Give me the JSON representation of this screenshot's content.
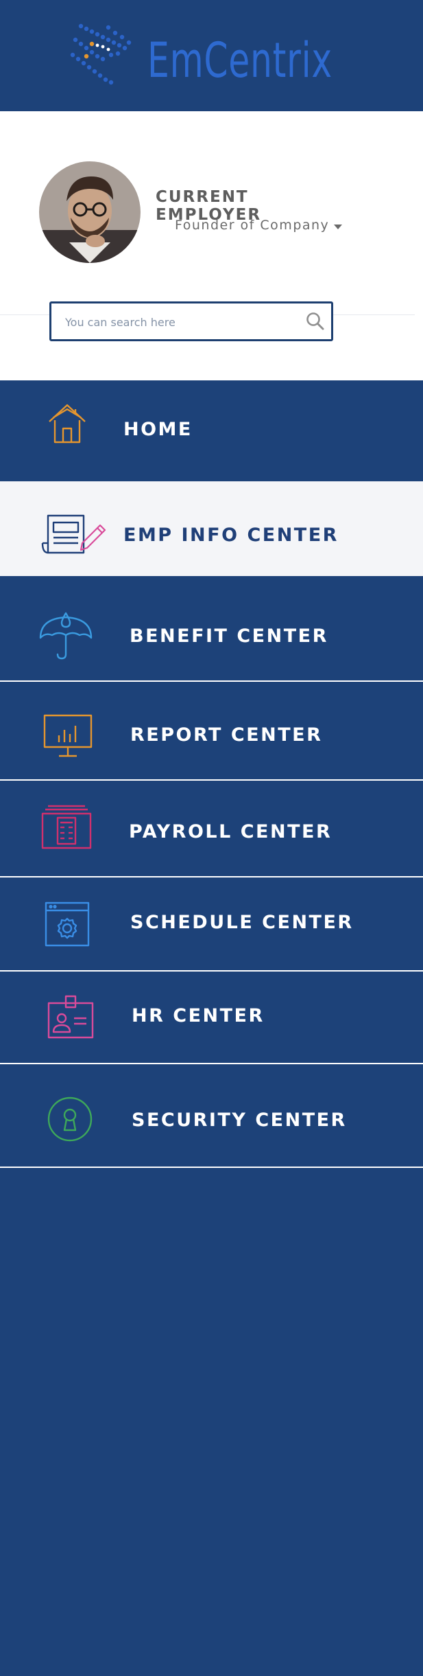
{
  "brand": {
    "name": "EmCentrix",
    "colors": {
      "primary": "#1d4279",
      "logo_text": "#2e6ad0",
      "active_bg": "#f4f5f8"
    }
  },
  "profile": {
    "avatar_icon": "user-avatar",
    "name": "CURRENT EMPLOYER",
    "role": "Founder of Company"
  },
  "search": {
    "placeholder": "You can search here",
    "value": "",
    "icon": "search-icon"
  },
  "nav": {
    "items": [
      {
        "label": "HOME",
        "icon": "home-icon",
        "icon_color": "#e5962e",
        "active": false
      },
      {
        "label": "EMP INFO CENTER",
        "icon": "document-pen-icon",
        "icon_color": "#1f3f78",
        "active": true
      },
      {
        "label": "BENEFIT CENTER",
        "icon": "umbrella-icon",
        "icon_color": "#3a9be0",
        "active": false
      },
      {
        "label": "REPORT CENTER",
        "icon": "presentation-chart-icon",
        "icon_color": "#e5962e",
        "active": false
      },
      {
        "label": "PAYROLL CENTER",
        "icon": "calculator-icon",
        "icon_color": "#d0306d",
        "active": false
      },
      {
        "label": "SCHEDULE CENTER",
        "icon": "gear-window-icon",
        "icon_color": "#3a8ee6",
        "active": false
      },
      {
        "label": "HR CENTER",
        "icon": "id-badge-icon",
        "icon_color": "#d94b9a",
        "active": false
      },
      {
        "label": "SECURITY CENTER",
        "icon": "keyhole-icon",
        "icon_color": "#3ea85a",
        "active": false
      }
    ]
  }
}
